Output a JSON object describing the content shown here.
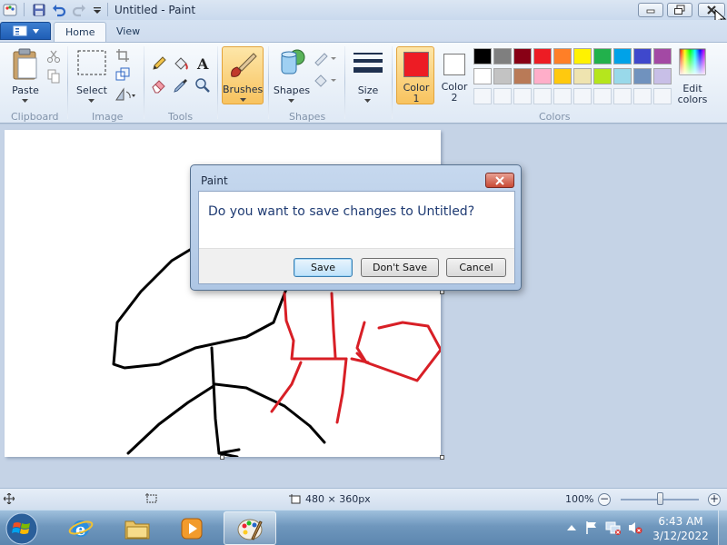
{
  "window": {
    "title": "Untitled - Paint",
    "minimize_icon": "minimize-icon",
    "restore_icon": "restore-icon",
    "close_icon": "close-icon"
  },
  "tabs": [
    {
      "label": "Home",
      "active": true
    },
    {
      "label": "View",
      "active": false
    }
  ],
  "ribbon": {
    "clipboard": {
      "label": "Clipboard",
      "paste": "Paste"
    },
    "image": {
      "label": "Image",
      "select": "Select"
    },
    "tools": {
      "label": "Tools"
    },
    "brushes": "Brushes",
    "shapes": {
      "label": "Shapes",
      "button": "Shapes"
    },
    "size": "Size",
    "color1": {
      "line1": "Color",
      "line2": "1",
      "value": "#ed1c24"
    },
    "color2": {
      "line1": "Color",
      "line2": "2",
      "value": "#ffffff"
    },
    "colors_label": "Colors",
    "edit_colors": {
      "line1": "Edit",
      "line2": "colors"
    },
    "palette_row1": [
      "#000000",
      "#7f7f7f",
      "#880015",
      "#ed1c24",
      "#ff7f27",
      "#fff200",
      "#22b14c",
      "#00a2e8",
      "#3f48cc",
      "#a349a4"
    ],
    "palette_row2": [
      "#ffffff",
      "#c3c3c3",
      "#b97a57",
      "#ffaec9",
      "#ffc90e",
      "#efe4b0",
      "#b5e61d",
      "#99d9ea",
      "#7092be",
      "#c8bfe7"
    ]
  },
  "dialog": {
    "title": "Paint",
    "message": "Do you want to save changes to Untitled?",
    "save": "Save",
    "dont_save": "Don't Save",
    "cancel": "Cancel"
  },
  "status": {
    "image_size": "480 × 360px",
    "zoom": "100%",
    "zoom_level": 1.0
  },
  "taskbar": {
    "time": "6:43 AM",
    "date": "3/12/2022"
  }
}
